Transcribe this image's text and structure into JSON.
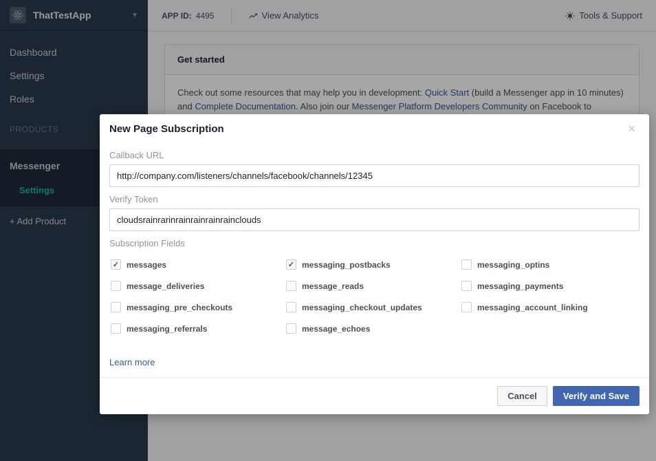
{
  "sidebar": {
    "app_name": "ThatTestApp",
    "nav": {
      "dashboard": "Dashboard",
      "settings": "Settings",
      "roles": "Roles"
    },
    "products_heading": "PRODUCTS",
    "messenger": "Messenger",
    "messenger_settings": "Settings",
    "add_product": "+ Add Product"
  },
  "topbar": {
    "appid_label": "APP ID:",
    "appid_value": "4495",
    "view_analytics": "View Analytics",
    "tools_support": "Tools & Support"
  },
  "content": {
    "get_started_title": "Get started",
    "intro_pre": "Check out some resources that may help you in development: ",
    "quick_start": "Quick Start",
    "intro_mid": " (build a Messenger app in 10 minutes) and ",
    "complete_docs": "Complete Documentation",
    "intro_mid2": ". Also join our ",
    "community": "Messenger Platform Developers Community",
    "intro_post": " on Facebook to"
  },
  "modal": {
    "title": "New Page Subscription",
    "callback_label": "Callback URL",
    "callback_value": "http://company.com/listeners/channels/facebook/channels/12345",
    "verify_label": "Verify Token",
    "verify_value": "cloudsrainrarinrainrainrainrainclouds",
    "fields_label": "Subscription Fields",
    "fields": [
      {
        "label": "messages",
        "checked": true
      },
      {
        "label": "messaging_postbacks",
        "checked": true
      },
      {
        "label": "messaging_optins",
        "checked": false
      },
      {
        "label": "message_deliveries",
        "checked": false
      },
      {
        "label": "message_reads",
        "checked": false
      },
      {
        "label": "messaging_payments",
        "checked": false
      },
      {
        "label": "messaging_pre_checkouts",
        "checked": false
      },
      {
        "label": "messaging_checkout_updates",
        "checked": false
      },
      {
        "label": "messaging_account_linking",
        "checked": false
      },
      {
        "label": "messaging_referrals",
        "checked": false
      },
      {
        "label": "message_echoes",
        "checked": false
      }
    ],
    "learn_more": "Learn more",
    "cancel": "Cancel",
    "verify_save": "Verify and Save"
  }
}
